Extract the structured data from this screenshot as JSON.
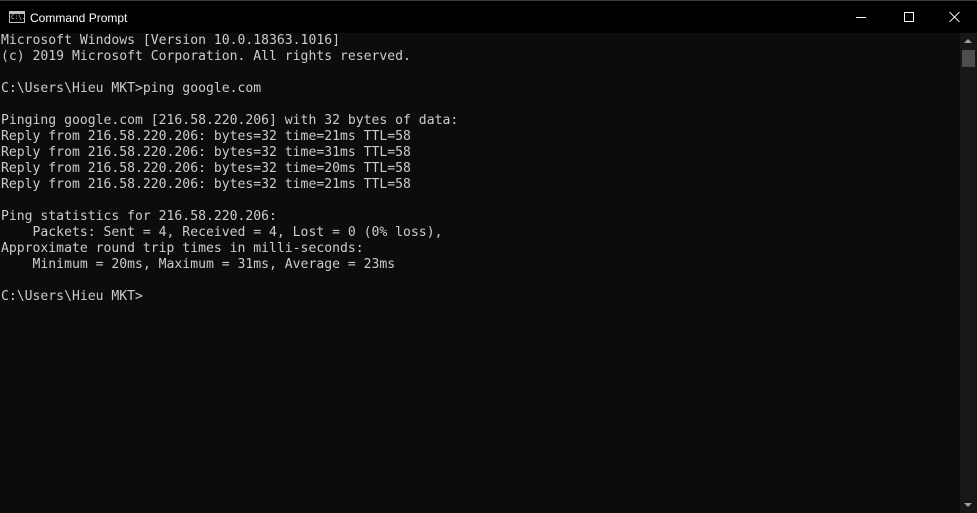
{
  "window": {
    "title": "Command Prompt",
    "icon": "cmd-icon",
    "icon_text": "C:\\."
  },
  "controls": {
    "minimize": "minimize-icon",
    "maximize": "maximize-icon",
    "close": "close-icon"
  },
  "colors": {
    "background": "#0c0c0c",
    "text": "#cccccc",
    "titlebar": "#000000",
    "scrollbar_track": "#171717",
    "scrollbar_thumb": "#4d4d4d"
  },
  "console": {
    "lines": [
      "Microsoft Windows [Version 10.0.18363.1016]",
      "(c) 2019 Microsoft Corporation. All rights reserved.",
      "",
      "C:\\Users\\Hieu MKT>ping google.com",
      "",
      "Pinging google.com [216.58.220.206] with 32 bytes of data:",
      "Reply from 216.58.220.206: bytes=32 time=21ms TTL=58",
      "Reply from 216.58.220.206: bytes=32 time=31ms TTL=58",
      "Reply from 216.58.220.206: bytes=32 time=20ms TTL=58",
      "Reply from 216.58.220.206: bytes=32 time=21ms TTL=58",
      "",
      "Ping statistics for 216.58.220.206:",
      "    Packets: Sent = 4, Received = 4, Lost = 0 (0% loss),",
      "Approximate round trip times in milli-seconds:",
      "    Minimum = 20ms, Maximum = 31ms, Average = 23ms",
      "",
      "C:\\Users\\Hieu MKT>"
    ]
  },
  "scrollbar": {
    "up": "arrow-up-icon",
    "down": "arrow-down-icon",
    "position": 0
  }
}
